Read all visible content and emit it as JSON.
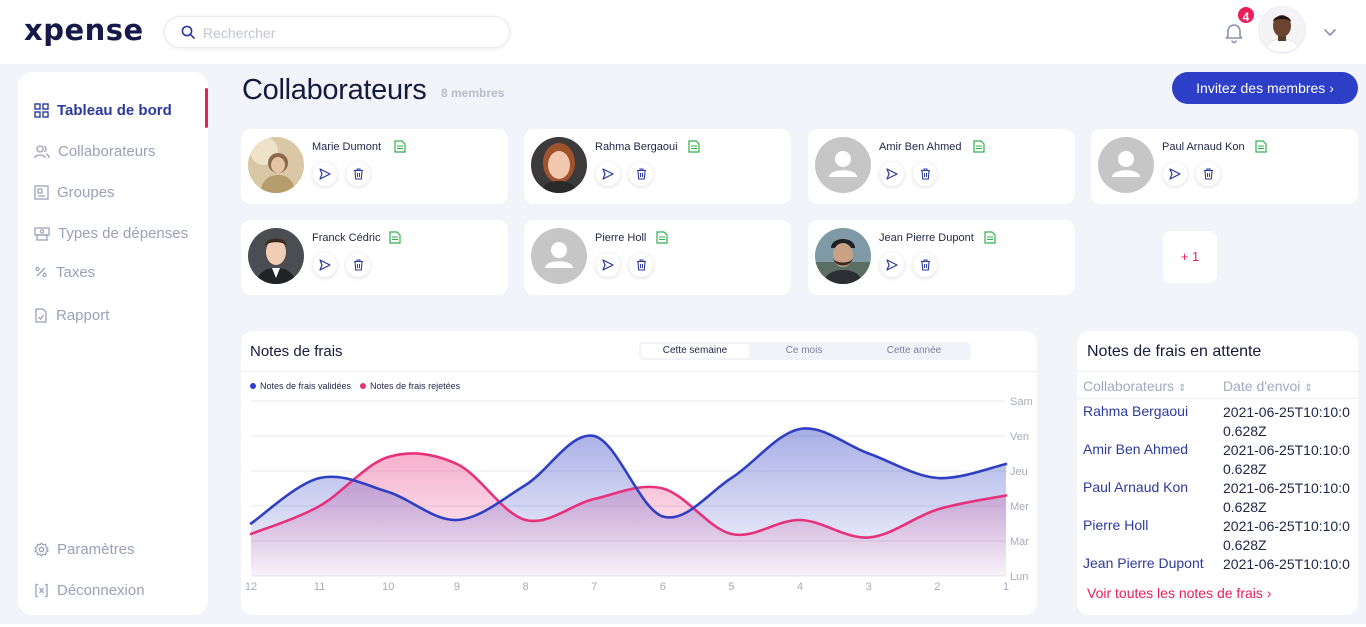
{
  "app": {
    "logo": "xpense"
  },
  "search": {
    "placeholder": "Rechercher"
  },
  "notifications": {
    "count": "4"
  },
  "sidebar": {
    "items": [
      {
        "label": "Tableau de bord",
        "icon": "grid-icon",
        "active": true
      },
      {
        "label": "Collaborateurs",
        "icon": "users-icon"
      },
      {
        "label": "Groupes",
        "icon": "group-icon"
      },
      {
        "label": "Types de dépenses",
        "icon": "cash-register-icon"
      },
      {
        "label": "Taxes",
        "icon": "percent-icon"
      },
      {
        "label": "Rapport",
        "icon": "report-icon"
      }
    ],
    "bottom": [
      {
        "label": "Paramètres",
        "icon": "gear-icon"
      },
      {
        "label": "Déconnexion",
        "icon": "logout-icon"
      }
    ]
  },
  "page": {
    "title": "Collaborateurs",
    "members_count": "8 membres",
    "invite_label": "Invitez des membres ›"
  },
  "members": [
    {
      "name": "Marie Dumont",
      "photo": "photo"
    },
    {
      "name": "Rahma Bergaoui",
      "photo": "photo"
    },
    {
      "name": "Amir Ben Ahmed",
      "photo": "placeholder"
    },
    {
      "name": "Paul Arnaud Kon",
      "photo": "placeholder"
    },
    {
      "name": "Franck Cédric",
      "photo": "photo"
    },
    {
      "name": "Pierre Holl",
      "photo": "placeholder"
    },
    {
      "name": "Jean Pierre Dupont",
      "photo": "photo"
    }
  ],
  "more_members": "+ 1",
  "chart": {
    "title": "Notes de frais",
    "periods": [
      "Cette semaine",
      "Ce mois",
      "Cette année"
    ],
    "selected_period": "Cette semaine"
  },
  "chart_data": {
    "type": "area",
    "x": [
      "12",
      "11",
      "10",
      "9",
      "8",
      "7",
      "6",
      "5",
      "4",
      "3",
      "2",
      "1"
    ],
    "y_ticks": [
      "Lun",
      "Mar",
      "Mer",
      "Jeu",
      "Ven",
      "Sam"
    ],
    "series": [
      {
        "name": "Notes de frais validées",
        "color": "#2f3fc4",
        "values": [
          1.5,
          2.8,
          2.4,
          1.6,
          2.6,
          4.0,
          1.7,
          2.8,
          4.2,
          3.5,
          2.8,
          3.2
        ]
      },
      {
        "name": "Notes de frais rejetées",
        "color": "#e8317b",
        "values": [
          1.2,
          2.0,
          3.4,
          3.2,
          1.6,
          2.2,
          2.5,
          1.2,
          1.6,
          1.1,
          1.9,
          2.3
        ]
      }
    ],
    "ylim": [
      0,
      5
    ],
    "grid": true,
    "legend": "top-left"
  },
  "pending": {
    "title": "Notes de frais en attente",
    "col_collab": "Collaborateurs",
    "col_date": "Date d'envoi",
    "rows": [
      {
        "name": "Rahma Bergaoui",
        "date": "2021-06-25T10:10:00.628Z"
      },
      {
        "name": "Amir Ben Ahmed",
        "date": "2021-06-25T10:10:00.628Z"
      },
      {
        "name": "Paul Arnaud Kon",
        "date": "2021-06-25T10:10:00.628Z"
      },
      {
        "name": "Pierre Holl",
        "date": "2021-06-25T10:10:00.628Z"
      },
      {
        "name": "Jean Pierre Dupont",
        "date": "2021-06-25T10:10:00.628Z"
      }
    ],
    "see_all": "Voir toutes les notes de frais ›"
  }
}
